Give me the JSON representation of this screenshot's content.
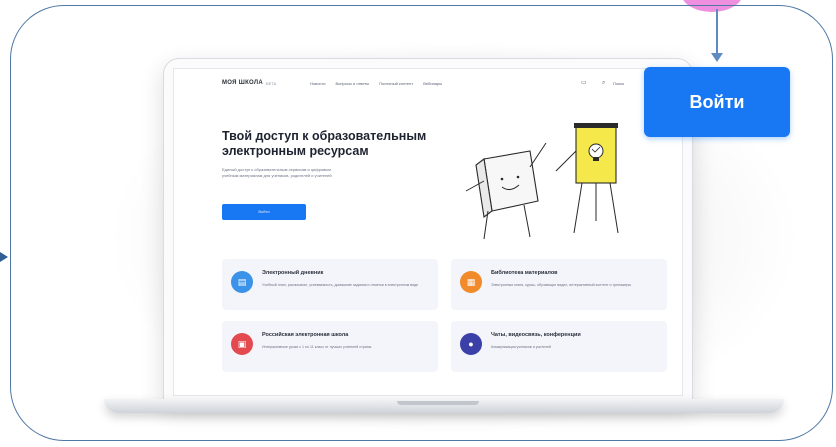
{
  "site": {
    "logo": "МОЯ ШКОЛА",
    "logo_tag": "БЕТА",
    "nav": [
      "Новости",
      "Вопросы и ответы",
      "Полезный контент",
      "Вебинары"
    ],
    "search_label": "Поиск",
    "hero": {
      "title": "Твой доступ к образовательным электронным ресурсам",
      "subtitle": "Единый доступ к образовательным сервисам и цифровым учебным материалам для учеников, родителей и учителей",
      "button_label": "Войти"
    },
    "cards": [
      {
        "title": "Электронный дневник",
        "desc": "Учебный план, расписание, успеваемость, домашние задания и отметки в электронном виде",
        "icon": "book-icon",
        "color": "#3a93e8"
      },
      {
        "title": "Библиотека материалов",
        "desc": "Электронные книги, курсы, обучающие видео, интерактивный контент и тренажеры",
        "icon": "library-icon",
        "color": "#f08a2a"
      },
      {
        "title": "Российская электронная школа",
        "desc": "Интерактивные уроки с 1 по 11 класс от лучших учителей страны",
        "icon": "school-icon",
        "color": "#e24a50"
      },
      {
        "title": "Чаты, видеосвязь, конференции",
        "desc": "Коммуникация учеников и учителей",
        "icon": "chat-icon",
        "color": "#3b3fa8"
      }
    ]
  },
  "callout": {
    "login_label": "Войти"
  },
  "colors": {
    "primary": "#1877f2",
    "frame": "#4f78a4",
    "pink": "#ee8fe0"
  }
}
